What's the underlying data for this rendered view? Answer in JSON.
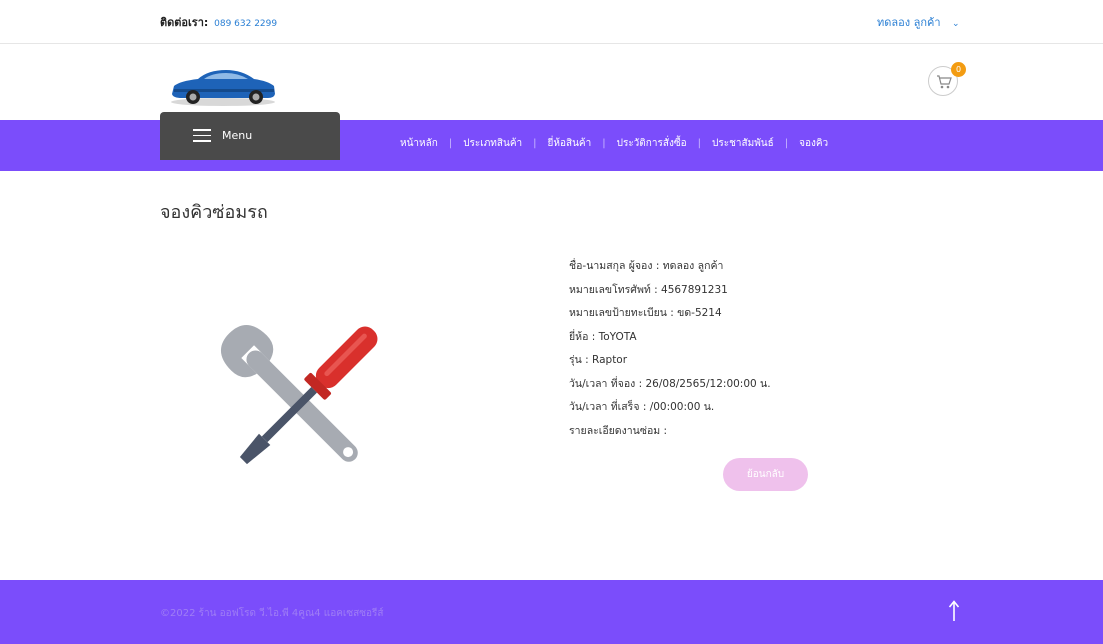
{
  "topbar": {
    "contact_label": "ติดต่อเรา:",
    "contact_phone": "089 632 2299",
    "user_name": "ทดลอง ลูกค้า",
    "user_chevron": "chevron-down-icon"
  },
  "header": {
    "logo": "car-logo",
    "cart_count": "0",
    "cart_icon": "shopping-cart-icon"
  },
  "nav": {
    "menu_label": "Menu",
    "items": [
      {
        "label": "หน้าหลัก"
      },
      {
        "label": "ประเภทสินค้า"
      },
      {
        "label": "ยี่ห้อสินค้า"
      },
      {
        "label": "ประวัติการสั่งซื้อ"
      },
      {
        "label": "ประชาสัมพันธ์"
      },
      {
        "label": "จองคิว"
      }
    ]
  },
  "main": {
    "title": "จองคิวซ่อมรถ",
    "illustration": "wrench-screwdriver-icon",
    "details": [
      {
        "text": "ชื่อ-นามสกุล ผู้จอง : ทดลอง ลูกค้า"
      },
      {
        "text": "หมายเลขโทรศัพท์ : 4567891231"
      },
      {
        "text": "หมายเลขป้ายทะเบียน : ขด-5214"
      },
      {
        "text": "ยี่ห้อ : ToYOTA"
      },
      {
        "text": "รุ่น : Raptor"
      },
      {
        "text": "วัน/เวลา ที่จอง : 26/08/2565/12:00:00 น."
      },
      {
        "text": "วัน/เวลา ที่เสร็จ : /00:00:00 น."
      },
      {
        "text": "รายละเอียดงานซ่อม :"
      }
    ],
    "back_label": "ย้อนกลับ"
  },
  "footer": {
    "copyright": "©2022 ร้าน ออฟโรด วี.ไอ.พี 4คูณ4 แอคเซสซอรีส์",
    "to_top_icon": "arrow-up-icon"
  },
  "colors": {
    "accent": "#7b4dfb",
    "menu_bg": "#4a4a4a",
    "back_button": "#efc1ec",
    "badge": "#f39c12",
    "link": "#2a7fd4"
  }
}
